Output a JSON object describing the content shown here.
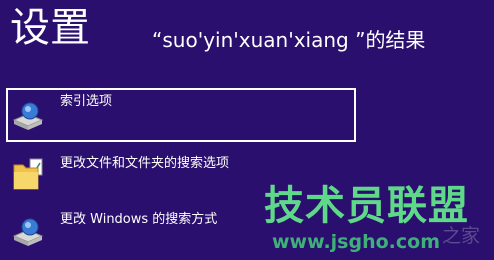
{
  "header": {
    "title": "设置",
    "query": "“suo'yin'xuan'xiang ”的结果"
  },
  "results": [
    {
      "label": "索引选项",
      "icon": "indexing-options-icon",
      "selected": true
    },
    {
      "label": "更改文件和文件夹的搜索选项",
      "icon": "folder-options-icon",
      "selected": false
    },
    {
      "label": "更改 Windows 的搜索方式",
      "icon": "search-settings-icon",
      "selected": false
    }
  ],
  "watermark": {
    "main": "技术员联盟",
    "url": "www.jsgho.com",
    "suffix": "之家"
  }
}
